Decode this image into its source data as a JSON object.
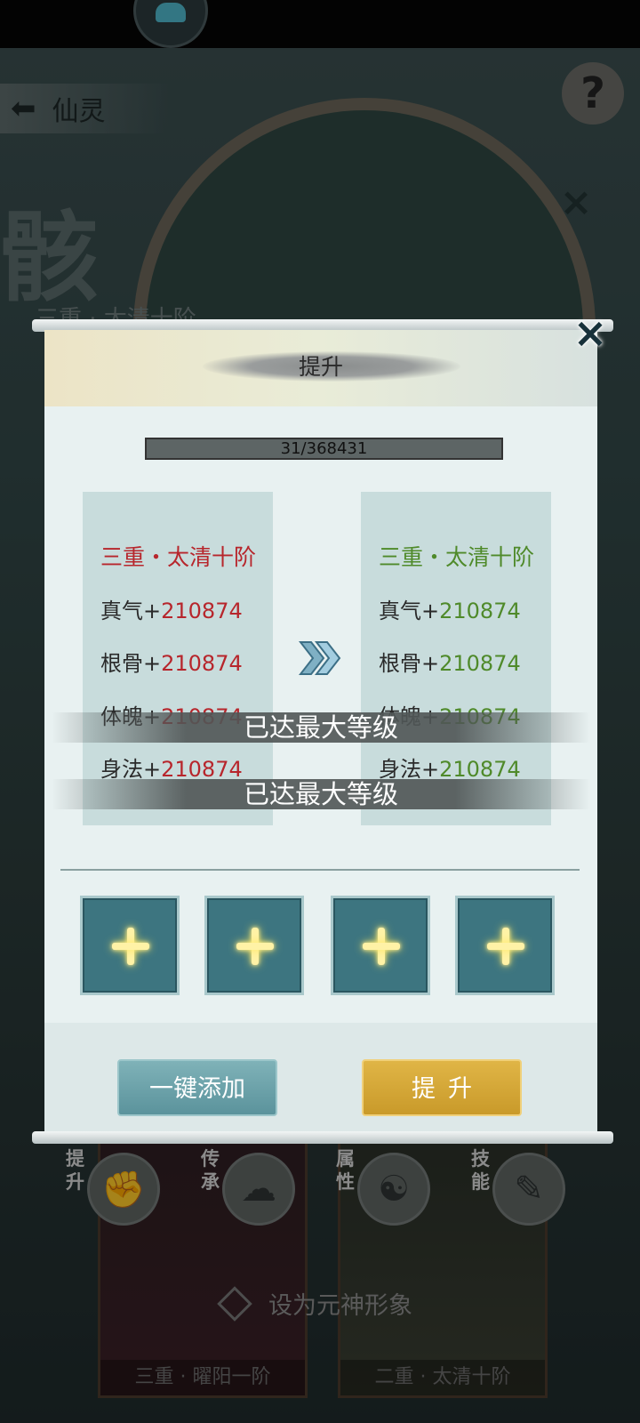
{
  "background": {
    "back_label": "仙灵",
    "back_icon": "back-arrow-icon",
    "help_icon": "help-icon",
    "help_glyph": "?",
    "big_char": "骸",
    "subtitle": "三重 · 太清十阶",
    "side_labels": {
      "upgrade": "提升",
      "inherit": "传承",
      "attribute": "属性",
      "skill": "技能"
    },
    "card_captions": [
      "三重 · 曜阳一阶",
      "二重 · 太清十阶"
    ],
    "set_image_label": "设为元神形象"
  },
  "dialog": {
    "title": "提升",
    "close_icon": "close-icon",
    "progress": {
      "text": "31/368431",
      "current": 31,
      "total": 368431
    },
    "current": {
      "stage": "三重・太清十阶",
      "stats": [
        {
          "label": "真气+",
          "value": "210874"
        },
        {
          "label": "根骨+",
          "value": "210874"
        },
        {
          "label": "体魄+",
          "value": "210874"
        },
        {
          "label": "身法+",
          "value": "210874"
        }
      ]
    },
    "next": {
      "stage": "三重・太清十阶",
      "stats": [
        {
          "label": "真气+",
          "value": "210874"
        },
        {
          "label": "根骨+",
          "value": "210874"
        },
        {
          "label": "体魄+",
          "value": "210874"
        },
        {
          "label": "身法+",
          "value": "210874"
        }
      ]
    },
    "max_level_banners": [
      "已达最大等级",
      "已达最大等级"
    ],
    "slots": [
      "add-material-slot",
      "add-material-slot",
      "add-material-slot",
      "add-material-slot"
    ],
    "buttons": {
      "one_click_add": "一键添加",
      "upgrade": "提升"
    }
  },
  "colors": {
    "current_red": "#b7262c",
    "next_green": "#4f8a2a",
    "slot_teal": "#3d7580",
    "gold_button": "#d4a73a",
    "teal_button": "#6ea5ac"
  }
}
